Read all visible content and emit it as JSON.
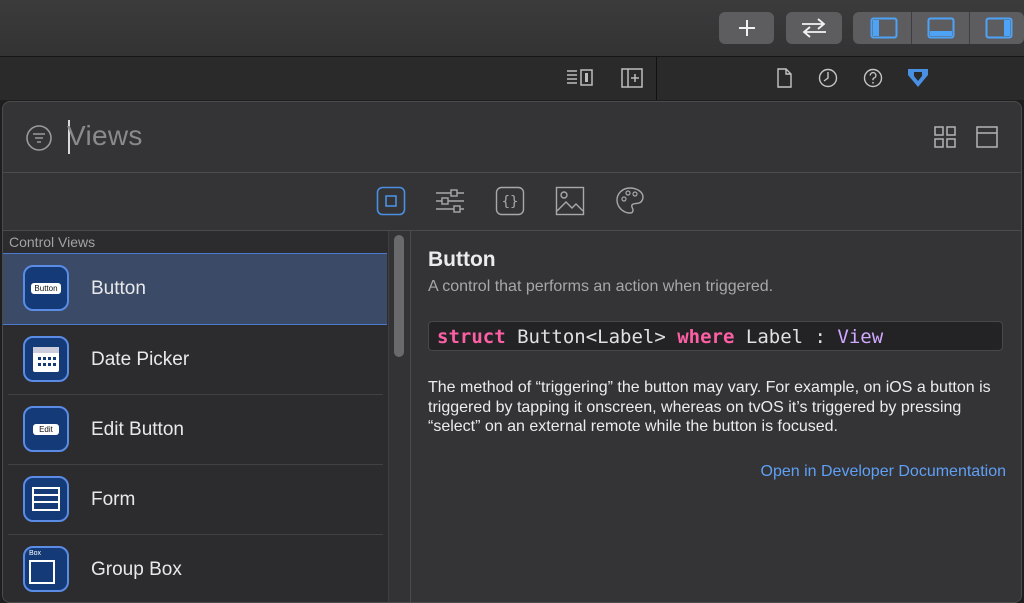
{
  "toolbar": {
    "add_icon": "plus-icon",
    "swap_icon": "swap-arrows-icon",
    "layout_icons": [
      "navigator-panel-icon",
      "debug-panel-icon",
      "inspector-panel-icon"
    ],
    "accent": "#4a90e2"
  },
  "subbar": {
    "left_icons": [
      "editor-options-icon",
      "add-editor-icon"
    ],
    "inspector_icons": [
      "file-inspector-icon",
      "history-icon",
      "help-icon",
      "attributes-inspector-icon"
    ]
  },
  "library": {
    "search": {
      "value": "",
      "placeholder": "Views"
    },
    "tabs": [
      "views-tab",
      "modifiers-tab",
      "snippets-tab",
      "media-tab",
      "colors-tab"
    ],
    "section_title": "Control Views",
    "items": [
      {
        "label": "Button",
        "icon_text": "Button"
      },
      {
        "label": "Date Picker",
        "icon_text": ""
      },
      {
        "label": "Edit Button",
        "icon_text": "Edit"
      },
      {
        "label": "Form",
        "icon_text": ""
      },
      {
        "label": "Group Box",
        "icon_text": "Box"
      }
    ]
  },
  "detail": {
    "title": "Button",
    "subtitle": "A control that performs an action when triggered.",
    "code": {
      "kw1": "struct",
      "mid": " Button<Label> ",
      "kw2": "where",
      "mid2": " Label : ",
      "type": "View"
    },
    "description": "The method of “triggering” the button may vary. For example, on iOS a button is triggered by tapping it onscreen, whereas on tvOS it’s triggered by pressing “select” on an external remote while the button is focused.",
    "link": "Open in Developer Documentation"
  },
  "colors": {
    "selection": "#3b4a66",
    "link": "#5fa0f5",
    "keyword": "#fc5fa3",
    "type": "#d0a8ff"
  }
}
